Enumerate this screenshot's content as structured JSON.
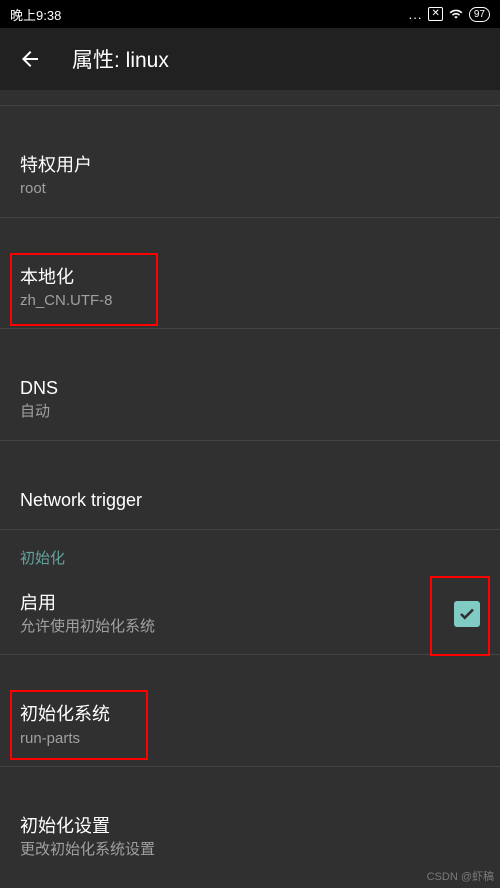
{
  "status_bar": {
    "time": "晚上9:38",
    "dots": "...",
    "box_icon": "✕",
    "battery": "97"
  },
  "app_bar": {
    "title": "属性: linux"
  },
  "items": {
    "privileged_user": {
      "title": "特权用户",
      "subtitle": "root"
    },
    "localization": {
      "title": "本地化",
      "subtitle": "zh_CN.UTF-8"
    },
    "dns": {
      "title": "DNS",
      "subtitle": "自动"
    },
    "network_trigger": {
      "title": "Network trigger"
    }
  },
  "section": {
    "init": "初始化"
  },
  "init_items": {
    "enable": {
      "title": "启用",
      "subtitle": "允许使用初始化系统",
      "checked": true
    },
    "init_system": {
      "title": "初始化系统",
      "subtitle": "run-parts"
    },
    "init_settings": {
      "title": "初始化设置",
      "subtitle": "更改初始化系统设置"
    }
  },
  "watermark": "CSDN @虾稿"
}
